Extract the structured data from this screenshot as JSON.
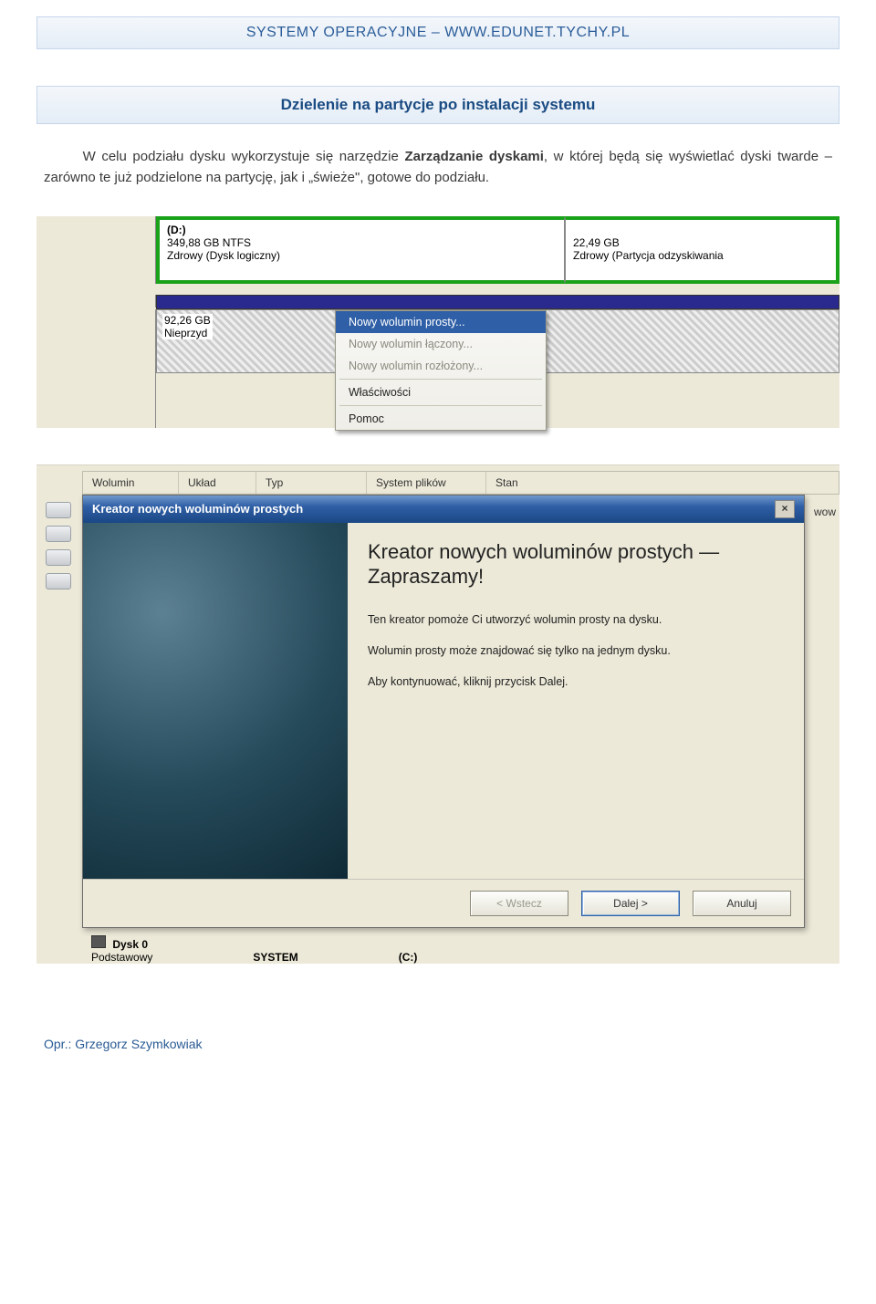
{
  "header": "SYSTEMY OPERACYJNE – WWW.EDUNET.TYCHY.PL",
  "title": "Dzielenie na partycje po instalacji systemu",
  "paragraph_parts": {
    "lead": "W celu podziału dysku wykorzystuje się narzędzie ",
    "bold": "Zarządzanie dyskami",
    "tail": ", w której będą się wyświetlać dyski twarde – zarówno te już podzielone na partycję, jak i „świeże\", gotowe do podziału."
  },
  "screenshot1": {
    "partition_d": {
      "letter": "(D:)",
      "size": "349,88 GB NTFS",
      "status": "Zdrowy (Dysk logiczny)"
    },
    "partition_recovery": {
      "size": "22,49 GB",
      "status": "Zdrowy (Partycja odzyskiwania"
    },
    "unallocated": {
      "size": "92,26 GB",
      "status": "Nieprzyd"
    },
    "context_menu": {
      "items": [
        {
          "label": "Nowy wolumin prosty...",
          "enabled": true,
          "selected": true
        },
        {
          "label": "Nowy wolumin łączony...",
          "enabled": false,
          "selected": false
        },
        {
          "label": "Nowy wolumin rozłożony...",
          "enabled": false,
          "selected": false
        }
      ],
      "properties": "Właściwości",
      "help": "Pomoc"
    }
  },
  "screenshot2": {
    "table_headers": [
      "Wolumin",
      "Układ",
      "Typ",
      "System plików",
      "Stan"
    ],
    "dialog_title": "Kreator nowych woluminów prostych",
    "heading": "Kreator nowych woluminów prostych — Zapraszamy!",
    "p1": "Ten kreator pomoże Ci utworzyć wolumin prosty na dysku.",
    "p2": "Wolumin prosty może znajdować się tylko na jednym dysku.",
    "p3": "Aby kontynuować, kliknij przycisk Dalej.",
    "buttons": {
      "back": "< Wstecz",
      "next": "Dalej >",
      "cancel": "Anuluj"
    },
    "right_fragment": "wow",
    "disk_footer": {
      "name": "Dysk 0",
      "type": "Podstawowy",
      "col2": "SYSTEM",
      "col3": "(C:)"
    }
  },
  "footer": "Opr.: Grzegorz Szymkowiak"
}
